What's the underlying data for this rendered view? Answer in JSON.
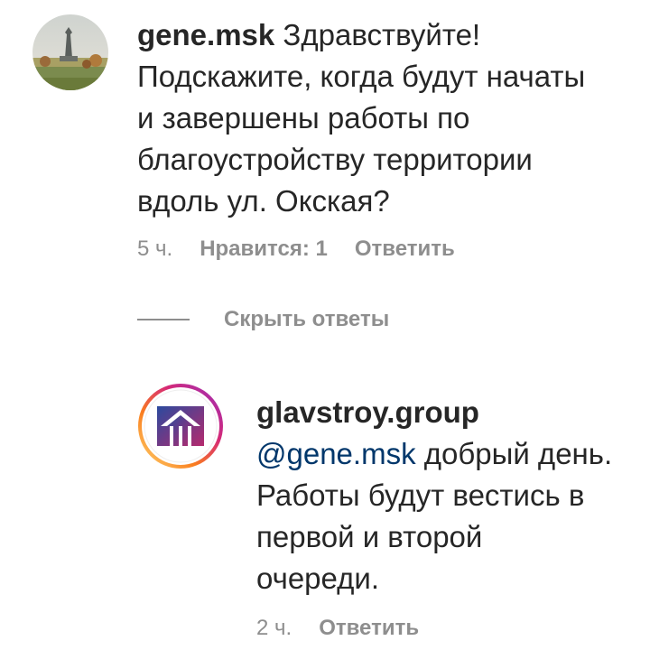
{
  "comment": {
    "username": "gene.msk",
    "lines": [
      "Здравствуйте!",
      "Подскажите, когда будут начаты",
      "и завершены работы по",
      "благоустройству территории",
      "вдоль ул. Окская?"
    ],
    "time": "5 ч.",
    "likes_label": "Нравится: 1",
    "reply_label": "Ответить"
  },
  "hide_replies_label": "Скрыть ответы",
  "reply": {
    "username": "glavstroy.group",
    "mention": "@gene.msk",
    "lines": [
      "добрый день.",
      "Работы будут вестись в",
      "первой и второй",
      "очереди."
    ],
    "time": "2 ч.",
    "reply_label": "Ответить"
  },
  "colors": {
    "text": "#262626",
    "secondary": "#8e8e8e",
    "mention": "#00376b",
    "logo_blue": "#2b4a9e",
    "logo_magenta": "#b52a6e",
    "story_ring_start": "#feda75",
    "story_ring_end": "#d62976"
  },
  "icons": {
    "commenter_avatar": "landscape-photo-avatar",
    "reply_avatar": "glavstroy-logo"
  }
}
